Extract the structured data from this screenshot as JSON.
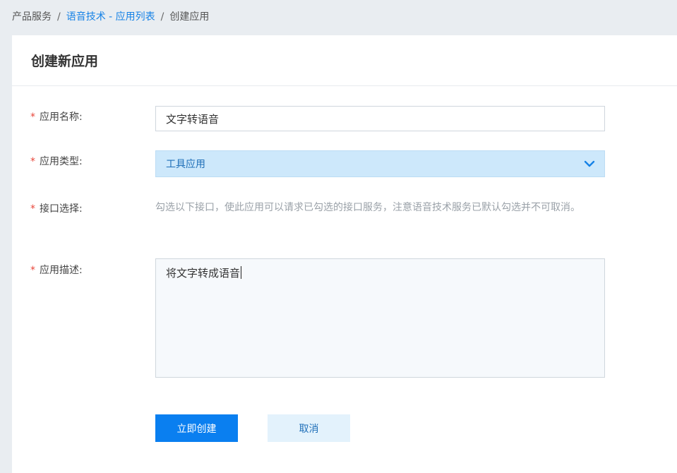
{
  "breadcrumb": {
    "items": [
      "产品服务",
      "语音技术 - 应用列表",
      "创建应用"
    ],
    "separator": "/"
  },
  "card": {
    "title": "创建新应用"
  },
  "form": {
    "required_mark": "*",
    "name": {
      "label": "应用名称:",
      "value": "文字转语音"
    },
    "type": {
      "label": "应用类型:",
      "value": "工具应用",
      "icon": "chevron-down-icon"
    },
    "interface": {
      "label": "接口选择:",
      "hint": "勾选以下接口，使此应用可以请求已勾选的接口服务，注意语音技术服务已默认勾选并不可取消。"
    },
    "description": {
      "label": "应用描述:",
      "value": "将文字转成语音"
    }
  },
  "actions": {
    "create_label": "立即创建",
    "cancel_label": "取消"
  },
  "colors": {
    "primary": "#0a7ff0",
    "link": "#1682e6",
    "required": "#e8463a",
    "select_bg": "#cde8fb"
  }
}
